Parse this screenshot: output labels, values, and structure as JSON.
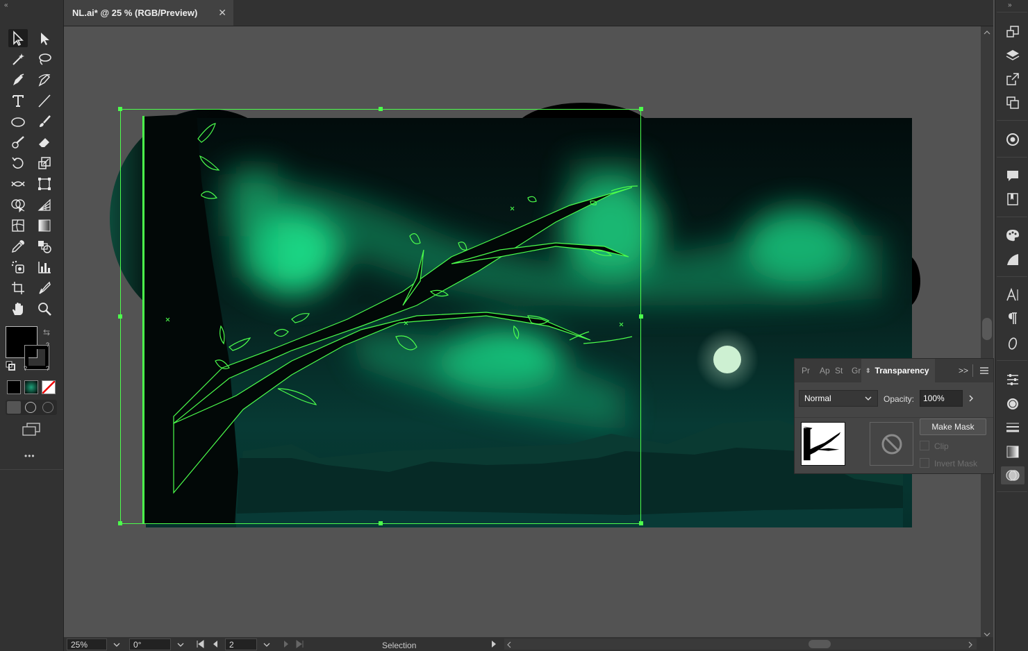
{
  "document_tab": {
    "title": "NL.ai* @ 25 % (RGB/Preview)",
    "close": "✕"
  },
  "toolbar": {
    "collapse": "«",
    "tools": [
      {
        "name": "selection-tool",
        "icon": "arrow-icon"
      },
      {
        "name": "direct-selection-tool",
        "icon": "white-arrow-icon"
      },
      {
        "name": "magic-wand-tool",
        "icon": "magic-wand-icon"
      },
      {
        "name": "lasso-tool",
        "icon": "lasso-icon"
      },
      {
        "name": "pen-tool",
        "icon": "pen-icon"
      },
      {
        "name": "curvature-tool",
        "icon": "curvature-icon"
      },
      {
        "name": "type-tool",
        "icon": "type-icon"
      },
      {
        "name": "line-segment-tool",
        "icon": "line-icon"
      },
      {
        "name": "ellipse-tool",
        "icon": "ellipse-icon"
      },
      {
        "name": "paintbrush-tool",
        "icon": "brush-icon"
      },
      {
        "name": "shaper-tool",
        "icon": "shaper-icon"
      },
      {
        "name": "eraser-tool",
        "icon": "eraser-icon"
      },
      {
        "name": "rotate-tool",
        "icon": "rotate-icon"
      },
      {
        "name": "scale-tool",
        "icon": "scale-icon"
      },
      {
        "name": "width-tool",
        "icon": "width-icon"
      },
      {
        "name": "free-transform-tool",
        "icon": "free-transform-icon"
      },
      {
        "name": "shape-builder-tool",
        "icon": "shape-builder-icon"
      },
      {
        "name": "perspective-grid-tool",
        "icon": "perspective-icon"
      },
      {
        "name": "mesh-tool",
        "icon": "mesh-icon"
      },
      {
        "name": "gradient-tool",
        "icon": "gradient-icon"
      },
      {
        "name": "eyedropper-tool",
        "icon": "eyedropper-icon"
      },
      {
        "name": "blend-tool",
        "icon": "blend-icon"
      },
      {
        "name": "symbol-sprayer-tool",
        "icon": "symbol-sprayer-icon"
      },
      {
        "name": "column-graph-tool",
        "icon": "graph-icon"
      },
      {
        "name": "artboard-tool",
        "icon": "artboard-icon"
      },
      {
        "name": "slice-tool",
        "icon": "slice-icon"
      },
      {
        "name": "hand-tool",
        "icon": "hand-icon"
      },
      {
        "name": "zoom-tool",
        "icon": "zoom-icon"
      }
    ],
    "fill_stroke_hint": "?",
    "more": "•••"
  },
  "status_bar": {
    "zoom": "25%",
    "rotation": "0°",
    "artboard_number": "2",
    "current_tool": "Selection"
  },
  "transparency_panel": {
    "tabs": [
      "Pr",
      "Ap",
      "St",
      "Gr"
    ],
    "active_tab": "Transparency",
    "expand_label": ">>",
    "blend_mode": "Normal",
    "opacity_label": "Opacity:",
    "opacity_value": "100%",
    "make_mask_label": "Make Mask",
    "clip_label": "Clip",
    "invert_mask_label": "Invert Mask"
  },
  "colors": {
    "ui_dark": "#323232",
    "canvas_gray": "#535353",
    "selection_green": "#4cff4c",
    "artwork_dark": "#031313",
    "aurora": "#1fe08a",
    "moon": "#cdf0d2"
  },
  "dock_icons": [
    "artboards-icon",
    "layers-icon",
    "export-icon",
    "libraries-icon",
    "recolor-icon",
    "comments-icon",
    "learn-icon",
    "color-themes-icon",
    "swatches-icon",
    "character-icon",
    "paragraph-icon",
    "opentype-icon",
    "properties-icon",
    "appearance-icon",
    "stroke-icon",
    "gradient-icon",
    "transparency-icon"
  ]
}
